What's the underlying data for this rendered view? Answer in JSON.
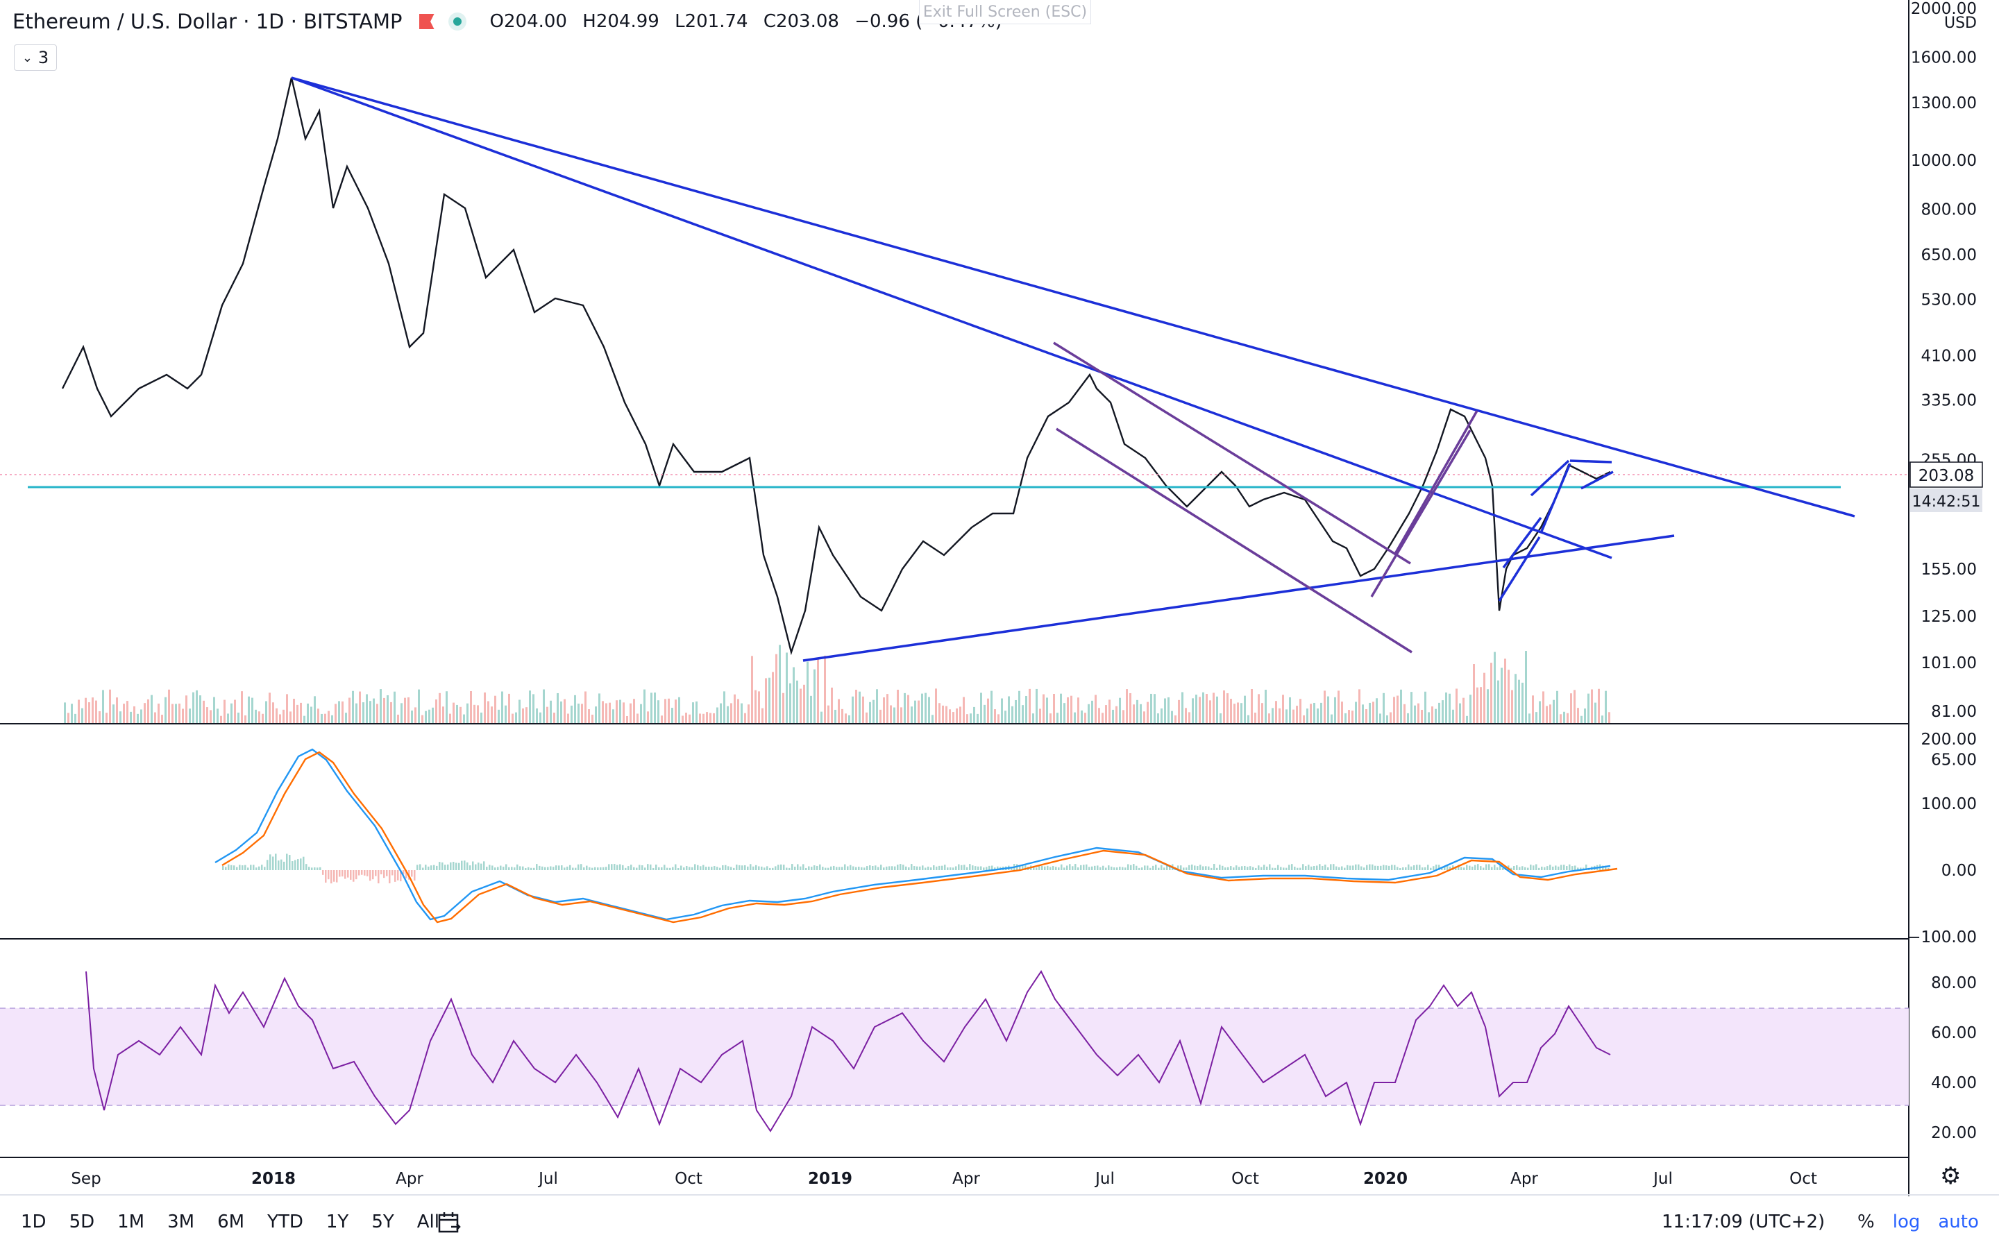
{
  "legend": {
    "symbol": "Ethereum / U.S. Dollar · 1D · BITSTAMP",
    "open_label": "O",
    "open": "204.00",
    "high_label": "H",
    "high": "204.99",
    "low_label": "L",
    "low": "201.74",
    "close_label": "C",
    "close": "203.08",
    "change": "−0.96 (−0.47%)"
  },
  "indicators_button": {
    "count": "3"
  },
  "exit_fullscreen": "Exit Full Screen (ESC)",
  "price_axis": {
    "currency": "USD",
    "ticks": [
      "2000.00",
      "1600.00",
      "1300.00",
      "1000.00",
      "800.00",
      "650.00",
      "530.00",
      "410.00",
      "335.00",
      "255.00",
      "155.00",
      "125.00",
      "101.00",
      "81.00",
      "65.00"
    ],
    "last_price": "203.08",
    "countdown": "14:42:51"
  },
  "macd_axis": {
    "ticks": [
      "200.00",
      "100.00",
      "0.00",
      "−100.00"
    ]
  },
  "rsi_axis": {
    "ticks": [
      "80.00",
      "60.00",
      "40.00",
      "20.00"
    ]
  },
  "time_axis": {
    "labels": [
      {
        "t": "Sep",
        "bold": false
      },
      {
        "t": "2018",
        "bold": true
      },
      {
        "t": "Apr",
        "bold": false
      },
      {
        "t": "Jul",
        "bold": false
      },
      {
        "t": "Oct",
        "bold": false
      },
      {
        "t": "2019",
        "bold": true
      },
      {
        "t": "Apr",
        "bold": false
      },
      {
        "t": "Jul",
        "bold": false
      },
      {
        "t": "Oct",
        "bold": false
      },
      {
        "t": "2020",
        "bold": true
      },
      {
        "t": "Apr",
        "bold": false
      },
      {
        "t": "Jul",
        "bold": false
      },
      {
        "t": "Oct",
        "bold": false
      }
    ]
  },
  "bottom_bar": {
    "ranges": [
      "1D",
      "5D",
      "1M",
      "3M",
      "6M",
      "YTD",
      "1Y",
      "5Y",
      "All"
    ],
    "clock": "11:17:09 (UTC+2)",
    "percent": "%",
    "log": "log",
    "auto": "auto"
  },
  "colors": {
    "trendline": "#1c2fd8",
    "channel": "#6a3d9a",
    "support": "#26b5c9",
    "rsi_line": "#7b1fa2",
    "rsi_band": "#f3e5fb",
    "macd_line": "#2196f3",
    "signal_line": "#ff6d00",
    "vol_up": "#a5d6cf",
    "vol_down": "#f5b7b4"
  }
}
